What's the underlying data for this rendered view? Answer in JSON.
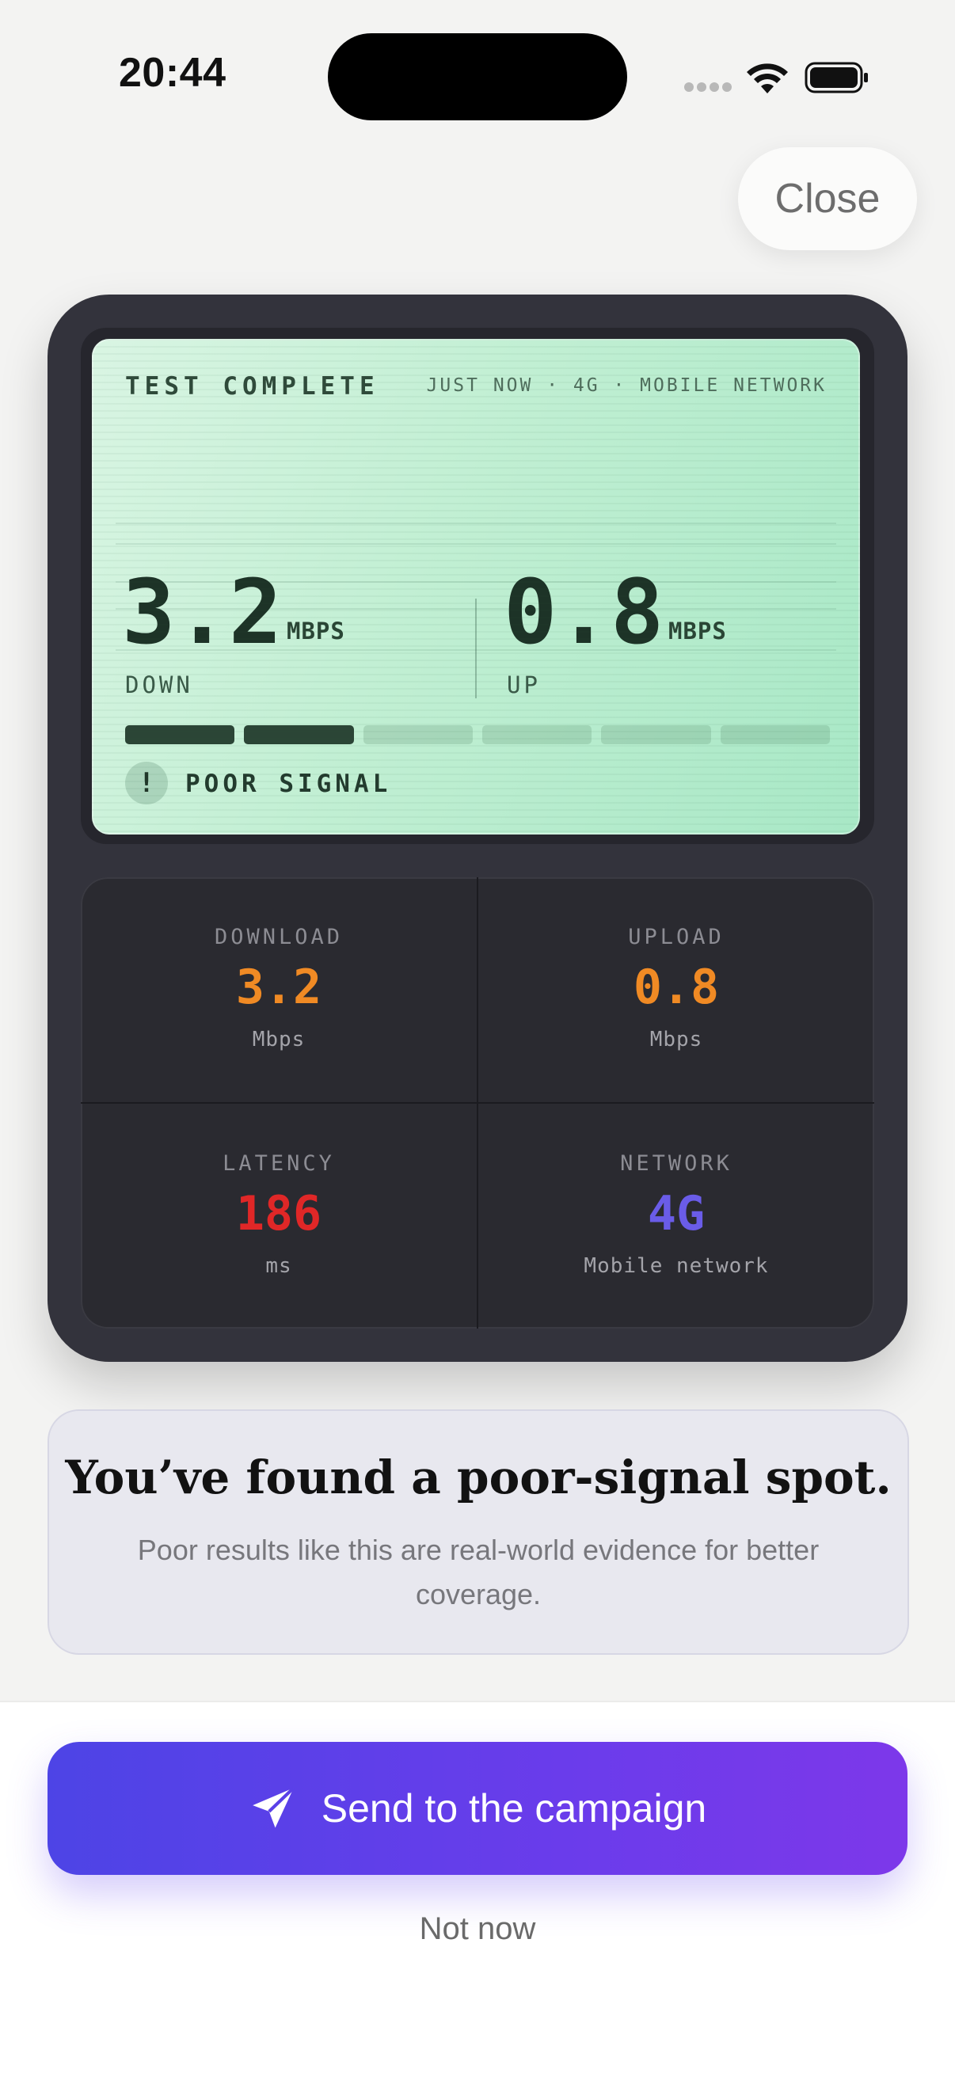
{
  "status_bar": {
    "time": "20:44"
  },
  "header": {
    "close_label": "Close"
  },
  "screen": {
    "title": "TEST COMPLETE",
    "meta": "JUST NOW · 4G · MOBILE NETWORK",
    "down_value": "3.2",
    "down_unit": "MBPS",
    "down_label": "DOWN",
    "up_value": "0.8",
    "up_unit": "MBPS",
    "up_label": "UP",
    "signal_bars_filled": 2,
    "signal_bars_total": 6,
    "signal_icon": "!",
    "signal_status": "POOR SIGNAL"
  },
  "stats": [
    {
      "label": "DOWNLOAD",
      "value": "3.2",
      "unit": "Mbps",
      "color": "#f08a24"
    },
    {
      "label": "UPLOAD",
      "value": "0.8",
      "unit": "Mbps",
      "color": "#f08a24"
    },
    {
      "label": "LATENCY",
      "value": "186",
      "unit": "ms",
      "color": "#e02727"
    },
    {
      "label": "NETWORK",
      "value": "4G",
      "unit": "Mobile network",
      "color": "#6a5ce8"
    }
  ],
  "message": {
    "title": "You’ve found a poor-signal spot.",
    "body": "Poor results like this are real-world evidence for better coverage."
  },
  "actions": {
    "send_icon": "paper-plane-icon",
    "send_label": "Send to the campaign",
    "not_now_label": "Not now"
  }
}
